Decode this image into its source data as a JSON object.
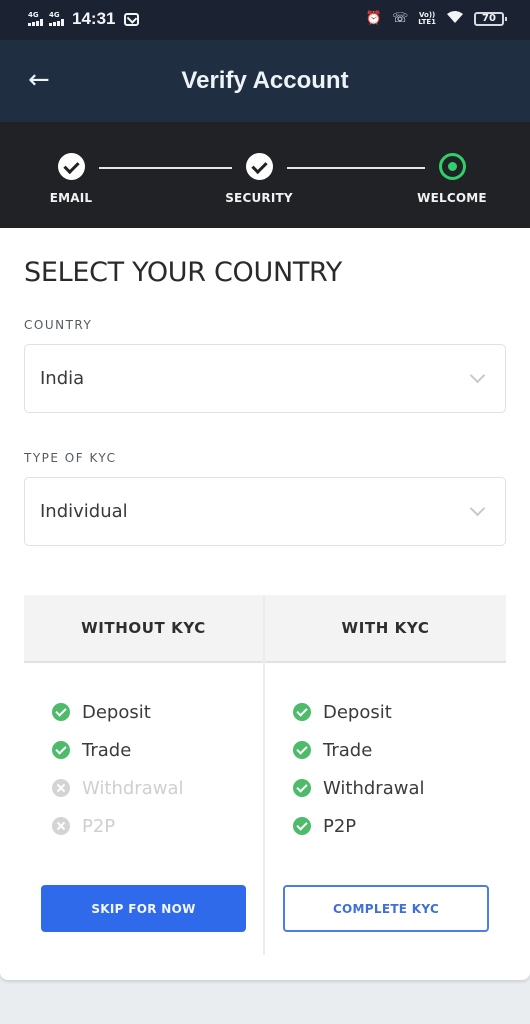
{
  "status_bar": {
    "signal_1": "4G",
    "signal_2": "4G",
    "time": "14:31",
    "volte_top": "Vo))",
    "volte_bottom": "LTE1",
    "battery": "70"
  },
  "app_bar": {
    "back_icon": "←",
    "title": "Verify Account"
  },
  "stepper": {
    "steps": [
      {
        "label": "EMAIL",
        "state": "done"
      },
      {
        "label": "SECURITY",
        "state": "done"
      },
      {
        "label": "WELCOME",
        "state": "active"
      }
    ],
    "active_color": "#2fcf6b"
  },
  "form": {
    "heading": "SELECT YOUR COUNTRY",
    "country_label": "COUNTRY",
    "country_value": "India",
    "kyc_type_label": "TYPE OF KYC",
    "kyc_type_value": "Individual"
  },
  "comparison": {
    "columns": [
      {
        "header": "WITHOUT KYC",
        "features": [
          {
            "label": "Deposit",
            "available": true
          },
          {
            "label": "Trade",
            "available": true
          },
          {
            "label": "Withdrawal",
            "available": false
          },
          {
            "label": "P2P",
            "available": false
          }
        ],
        "button": "SKIP FOR NOW"
      },
      {
        "header": "WITH KYC",
        "features": [
          {
            "label": "Deposit",
            "available": true
          },
          {
            "label": "Trade",
            "available": true
          },
          {
            "label": "Withdrawal",
            "available": true
          },
          {
            "label": "P2P",
            "available": true
          }
        ],
        "button": "COMPLETE KYC"
      }
    ],
    "accent_color": "#2f6aea",
    "check_color": "#4dbb6a"
  }
}
